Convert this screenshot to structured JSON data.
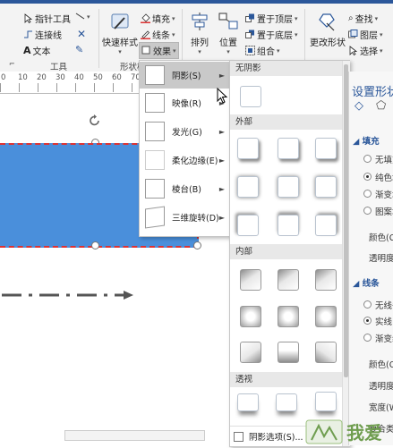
{
  "ribbon": {
    "tools": {
      "pointer": "指针工具",
      "connector": "连接线",
      "text": "文本",
      "group_label": "工具"
    },
    "shape_styles": {
      "quick_styles": "快速样式",
      "fill": "填充",
      "line": "线条",
      "effects": "效果",
      "group_label": "形状样"
    },
    "arrange": {
      "align": "排列",
      "position": "位置",
      "bring_front": "置于顶层",
      "send_back": "置于底层",
      "group": "组合"
    },
    "change_shape": "更改形状",
    "editing": {
      "find": "查找",
      "layers": "图层",
      "select": "选择"
    }
  },
  "ruler": {
    "ticks": [
      "0",
      "10",
      "20",
      "30",
      "40",
      "50",
      "60",
      "70"
    ]
  },
  "effects_menu": {
    "items": [
      {
        "label": "阴影(S)",
        "active": true
      },
      {
        "label": "映像(R)",
        "active": false
      },
      {
        "label": "发光(G)",
        "active": false
      },
      {
        "label": "柔化边缘(E)",
        "active": false
      },
      {
        "label": "棱台(B)",
        "active": false
      },
      {
        "label": "三维旋转(D)",
        "active": false
      }
    ]
  },
  "shadow_gallery": {
    "no_shadow": "无阴影",
    "outer": "外部",
    "inner": "内部",
    "perspective": "透视",
    "option": "阴影选项(S)..."
  },
  "format_pane": {
    "title": "设置形状",
    "fill_section": "填充",
    "fill_options": [
      "无填充",
      "纯色填充",
      "渐变填充",
      "图案填充"
    ],
    "color_label": "颜色(C)",
    "transparency_label": "透明度",
    "line_section": "线条",
    "line_options": [
      "无线条",
      "实线",
      "渐变线"
    ],
    "line_color_label": "颜色(O)",
    "line_transparency_label": "透明度",
    "width_label": "宽度(W)",
    "compound_label": "复合类型"
  },
  "watermark": {
    "text": "我爱"
  },
  "colors": {
    "shape_fill": "#4a8fdb",
    "shape_border": "#dd3333",
    "accent": "#2b579a"
  }
}
